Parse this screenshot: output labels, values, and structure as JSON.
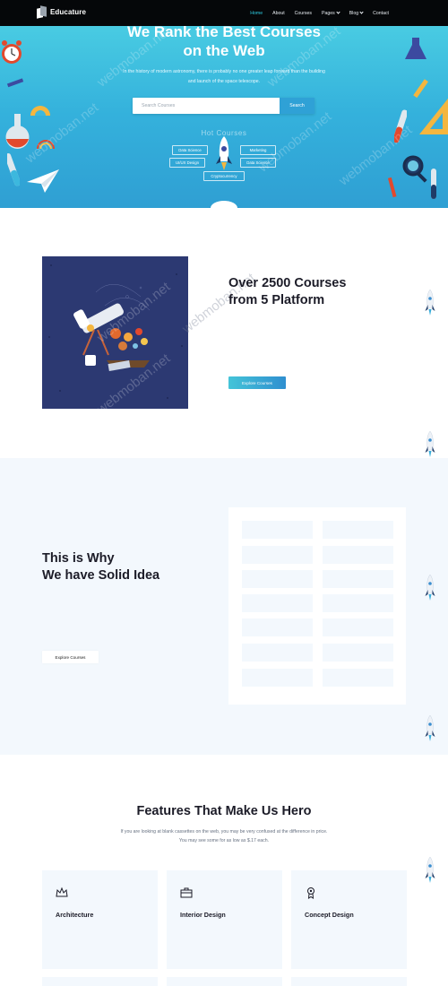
{
  "nav": {
    "brand": "Educature",
    "items": [
      {
        "label": "Home",
        "active": true,
        "dropdown": false
      },
      {
        "label": "About",
        "active": false,
        "dropdown": false
      },
      {
        "label": "Courses",
        "active": false,
        "dropdown": false
      },
      {
        "label": "Pages",
        "active": false,
        "dropdown": true
      },
      {
        "label": "Blog",
        "active": false,
        "dropdown": true
      },
      {
        "label": "Contact",
        "active": false,
        "dropdown": false
      }
    ]
  },
  "hero": {
    "title_line1": "We Rank the Best Courses",
    "title_line2": "on the Web",
    "subtitle": "In the history of modern astronomy, there is probably no one greater leap forward than the building and launch of the space telescope.",
    "search_placeholder": "Search Courses",
    "search_button": "Search",
    "hot_label": "Hot Courses",
    "tags": [
      "Data Science",
      "UI/UX Design",
      "Marketing",
      "Data Science",
      "Cryptocurrency"
    ]
  },
  "platform": {
    "title_line1": "Over 2500 Courses",
    "title_line2": "from 5 Platform",
    "button": "Explore Courses"
  },
  "idea": {
    "title_line1": "This is Why",
    "title_line2": "We have Solid Idea",
    "button": "Explore Courses"
  },
  "features": {
    "title": "Features That Make Us Hero",
    "subtitle_line1": "If you are looking at blank cassettes on the web, you may be very confused at the difference in price.",
    "subtitle_line2": "You may see some for as low as $.17 each.",
    "cards": [
      {
        "label": "Architecture",
        "icon": "crown-icon"
      },
      {
        "label": "Interior Design",
        "icon": "briefcase-icon"
      },
      {
        "label": "Concept Design",
        "icon": "medal-icon"
      }
    ]
  },
  "watermark": "webmoban.net",
  "colors": {
    "nav_bg": "#050709",
    "active_link": "#2ed0e6",
    "hero_top": "#4fd3e4",
    "hero_bottom": "#2f9fd3",
    "section_bg": "#f3f8fd",
    "illustration_bg": "#2c3972",
    "heading": "#1c1c28"
  }
}
